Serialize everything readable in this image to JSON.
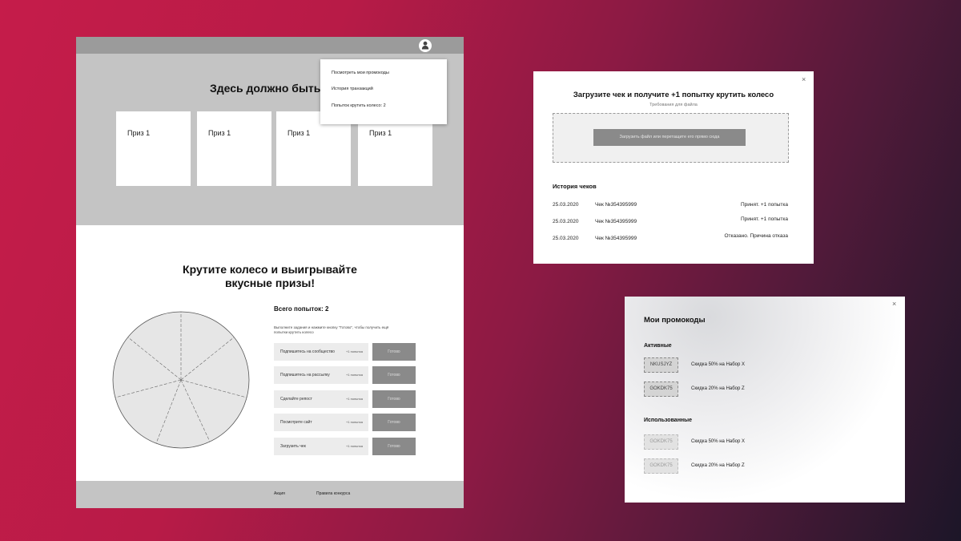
{
  "main_page": {
    "hero_title": "Здесь должно быть у",
    "prizes": [
      "Приз 1",
      "Приз 1",
      "Приз 1",
      "Приз 1"
    ],
    "dropdown": {
      "items": [
        "Посмотреть мои промокоды",
        "История транзакций",
        "Попыток крутить колесо: 2"
      ]
    },
    "wheel_title": "Крутите колесо и выигрывайте\nвкусные призы!",
    "attempts_title": "Всего попыток: 2",
    "attempts_desc": "Выполните задания и нажмите кнопку \"Готово\", чтобы получить ещё попытки крутить колесо",
    "tasks": [
      {
        "label": "Подпишитесь на сообщество",
        "bonus": "+1 попытка",
        "button": "Готово"
      },
      {
        "label": "Подпишитесь на рассылку",
        "bonus": "+1 попытка",
        "button": "Готово"
      },
      {
        "label": "Сделайте репост",
        "bonus": "+1 попытка",
        "button": "Готово"
      },
      {
        "label": "Посмотрите сайт",
        "bonus": "+1 попытка",
        "button": "Готово"
      },
      {
        "label": "Загрузить чек",
        "bonus": "+1 попытка",
        "button": "Готово"
      }
    ],
    "footer_links": [
      "Акция",
      "Правила конкурса"
    ]
  },
  "upload_modal": {
    "close": "×",
    "title": "Загрузите чек и получите +1 попытку крутить колесо",
    "subtitle": "Требования для файла",
    "upload_button": "Загрузить файл или перетащите его прямо сюда",
    "history_title": "История чеков",
    "history": [
      {
        "date": "25.03.2020",
        "check": "Чек №354395999",
        "status": "Принят. +1 попытка"
      },
      {
        "date": "25.03.2020",
        "check": "Чек №354395999",
        "status": "Принят. +1 попытка"
      },
      {
        "date": "25.03.2020",
        "check": "Чек №354395999",
        "status": "Отказано. Причина отказа"
      }
    ]
  },
  "promo_modal": {
    "close": "×",
    "title": "Мои промокоды",
    "active_label": "Активные",
    "active": [
      {
        "code": "NKUSJYZ",
        "desc": "Скидка 50% на Набор X"
      },
      {
        "code": "GOKDK75",
        "desc": "Скидка 20% на Набор Z"
      }
    ],
    "used_label": "Использованные",
    "used": [
      {
        "code": "GOKDK75",
        "desc": "Скидка 50% на Набор X"
      },
      {
        "code": "GOKDK75",
        "desc": "Скидка 20% на Набор Z"
      }
    ]
  }
}
